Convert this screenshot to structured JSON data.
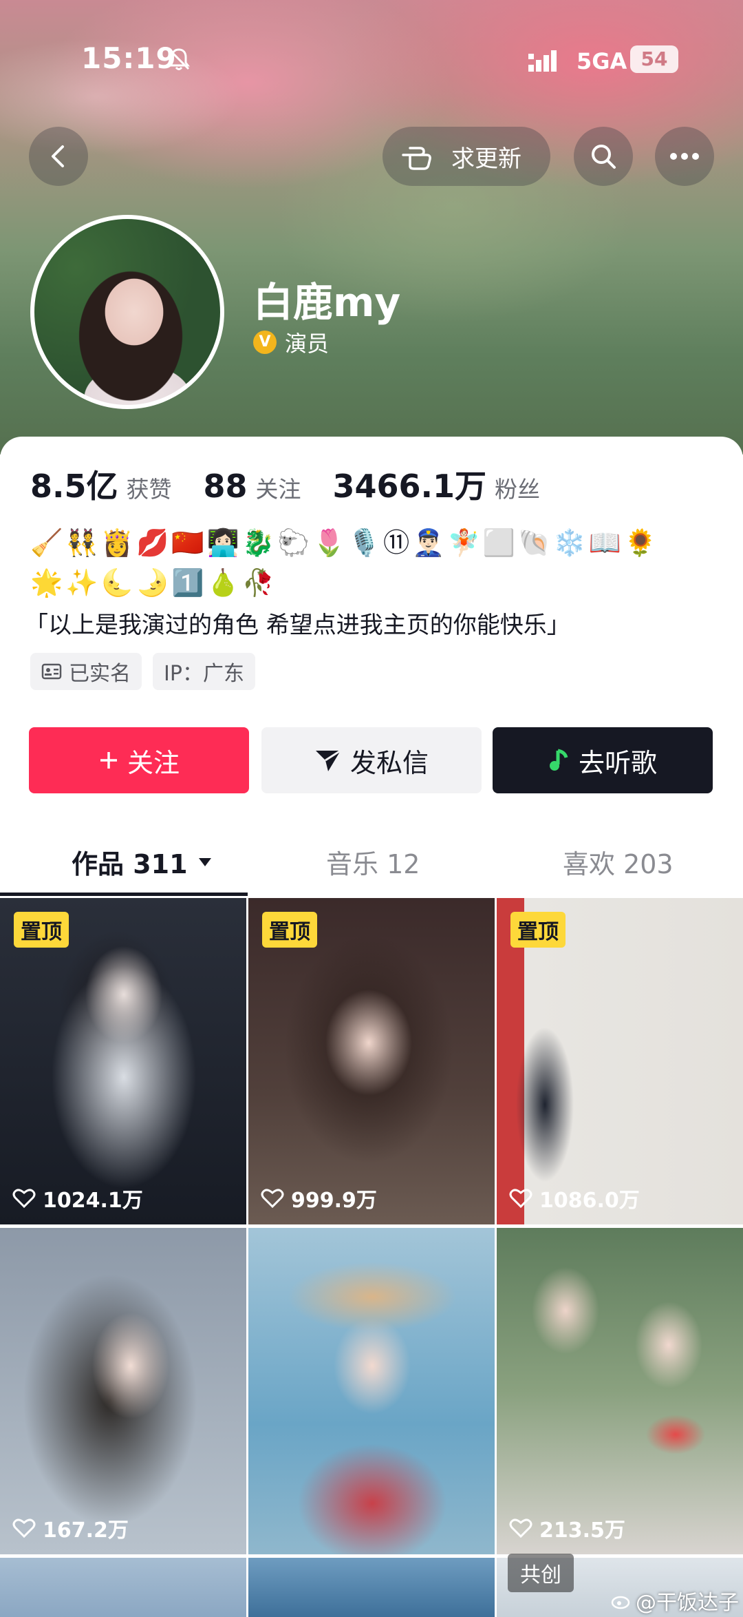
{
  "status_bar": {
    "time": "15:19",
    "network": "5GA",
    "battery": "54"
  },
  "top_nav": {
    "update_label": "求更新"
  },
  "profile": {
    "name": "白鹿my",
    "verify_badge": "V",
    "verification": "演员",
    "stats": [
      {
        "value": "8.5亿",
        "label": "获赞"
      },
      {
        "value": "88",
        "label": "关注"
      },
      {
        "value": "3466.1万",
        "label": "粉丝"
      }
    ],
    "emoji_line1": "🧹👯👸💋🇨🇳👩🏻‍💻🐉🐑🌷🎙️⑪👮🏻‍♂️🧚🏻⬜🐚❄️📖🌻",
    "emoji_line2": "🌟✨🌜🌛1️⃣🍐🥀",
    "bio": "「以上是我演过的角色 希望点进我主页的你能快乐」",
    "tags": [
      "已实名",
      "IP：广东"
    ]
  },
  "actions": {
    "follow": "关注",
    "message": "发私信",
    "listen": "去听歌"
  },
  "tabs": [
    {
      "label": "作品 311"
    },
    {
      "label": "音乐 12"
    },
    {
      "label": "喜欢 203"
    }
  ],
  "grid": {
    "pin_label": "置顶",
    "items": [
      {
        "likes": "1024.1万"
      },
      {
        "likes": "999.9万"
      },
      {
        "likes": "1086.0万"
      },
      {
        "likes": "167.2万"
      },
      {
        "likes": "213.5万"
      },
      {
        "likes": ""
      }
    ],
    "co_create_label": "共创"
  },
  "watermark": "@干饭达子",
  "colors": {
    "follow": "#fe2c55",
    "pin": "#fdd83a",
    "dark": "#161823",
    "verify": "#f3b51c"
  }
}
